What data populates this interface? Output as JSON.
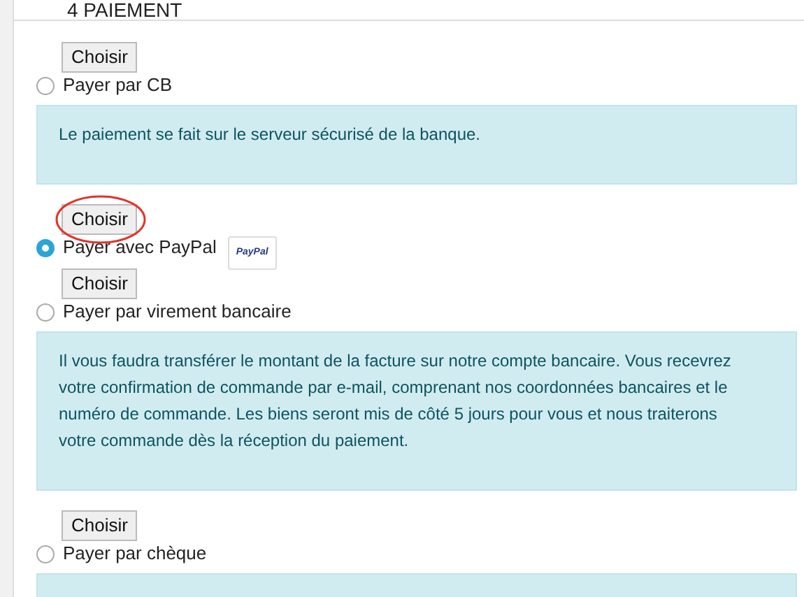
{
  "section_title": "4 PAIEMENT",
  "options": [
    {
      "button": "Choisir",
      "highlighted": false,
      "label": "Payer par CB",
      "selected": false,
      "panel": true,
      "note": "Le paiement se fait sur le serveur sécurisé de la banque."
    },
    {
      "button": "Choisir",
      "highlighted": true,
      "label": "Payer avec PayPal",
      "logo": "PayPal",
      "selected": true,
      "panel": false
    },
    {
      "button": "Choisir",
      "highlighted": false,
      "label": "Payer par virement bancaire",
      "selected": false,
      "panel": true,
      "note": "Il vous faudra transférer le montant de la facture sur notre compte bancaire. Vous recevrez votre confirmation de commande par e-mail, comprenant nos coordonnées bancaires et le numéro de commande. Les biens seront mis de côté 5 jours pour vous et nous traiterons votre commande dès la réception du paiement."
    },
    {
      "button": "Choisir",
      "highlighted": false,
      "label": "Payer par chèque",
      "selected": false,
      "panel": true
    }
  ]
}
